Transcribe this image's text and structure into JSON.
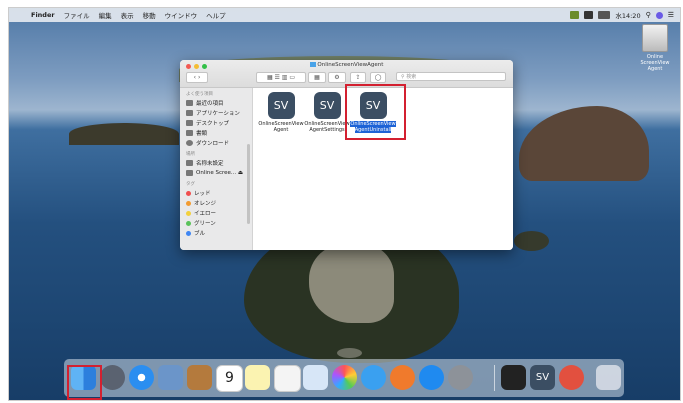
{
  "menubar": {
    "apple": "",
    "items": [
      "Finder",
      "ファイル",
      "編集",
      "表示",
      "移動",
      "ウインドウ",
      "ヘルプ"
    ],
    "clock": "水14:20"
  },
  "desktop_drive": {
    "label": "Online ScreenView Agent"
  },
  "window": {
    "title": "OnlineScreenViewAgent",
    "search_placeholder": "検索",
    "sidebar": {
      "favorites_header": "よく使う項目",
      "favorites": [
        "最近の項目",
        "アプリケーション",
        "デスクトップ",
        "書類",
        "ダウンロード"
      ],
      "locations_header": "場所",
      "locations": [
        "名称未設定",
        "Online Scree...  ⏏"
      ],
      "tags_header": "タグ",
      "tags": [
        "レッド",
        "オレンジ",
        "イエロー",
        "グリーン",
        "ブル"
      ],
      "tag_colors": [
        "#f04e4e",
        "#f29b30",
        "#f3d03c",
        "#5ac25a",
        "#3f86f3"
      ]
    },
    "files": [
      {
        "label1": "OnlineScreenView",
        "label2": "Agent",
        "icon_text": "SV"
      },
      {
        "label1": "OnlineScreenView",
        "label2": "AgentSettings",
        "icon_text": "SV"
      },
      {
        "label1": "OnlineScreenView",
        "label2": "AgentUninstall",
        "icon_text": "SV"
      }
    ]
  },
  "dock": {
    "calendar_day": "9",
    "sv_text": "SV"
  },
  "colors": {
    "highlight": "#d32030",
    "selection": "#1d63d6",
    "sv_icon": "#3b4e63"
  }
}
